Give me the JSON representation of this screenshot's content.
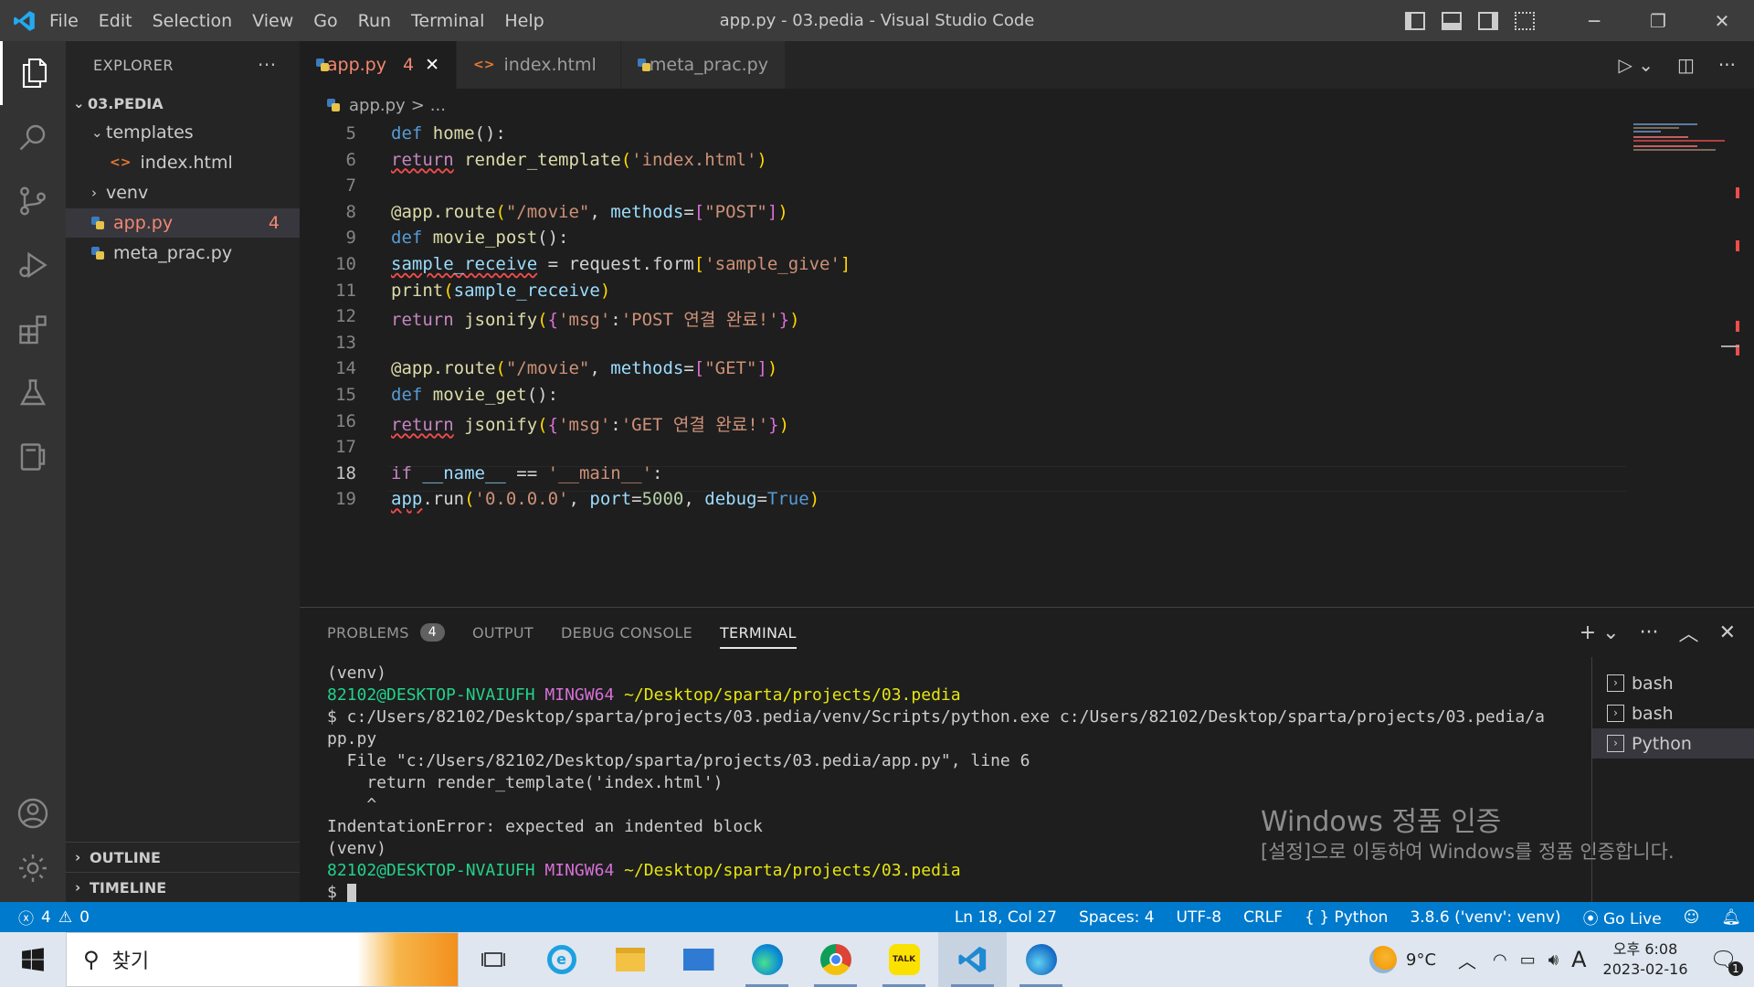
{
  "window": {
    "title": "app.py - 03.pedia - Visual Studio Code",
    "menu": [
      "File",
      "Edit",
      "Selection",
      "View",
      "Go",
      "Run",
      "Terminal",
      "Help"
    ]
  },
  "sidebar": {
    "header": "EXPLORER",
    "more": "···",
    "folder": "03.PEDIA",
    "items": [
      {
        "label": "templates",
        "type": "folder",
        "expanded": true
      },
      {
        "label": "index.html",
        "type": "html"
      },
      {
        "label": "venv",
        "type": "folder",
        "expanded": false
      },
      {
        "label": "app.py",
        "type": "python",
        "badge": "4",
        "active": true
      },
      {
        "label": "meta_prac.py",
        "type": "python"
      }
    ],
    "outline": "OUTLINE",
    "timeline": "TIMELINE"
  },
  "tabs": [
    {
      "label": "app.py",
      "badge": "4",
      "active": true,
      "icon": "python-icon"
    },
    {
      "label": "index.html",
      "icon": "html-icon"
    },
    {
      "label": "meta_prac.py",
      "icon": "python-icon"
    }
  ],
  "breadcrumb": {
    "file": "app.py",
    "sep": ">",
    "rest": "..."
  },
  "editor": {
    "lines": [
      {
        "n": "5",
        "parts": [
          [
            "kw",
            "def "
          ],
          [
            "fn",
            "home"
          ],
          [
            "",
            "():"
          ]
        ]
      },
      {
        "n": "6",
        "parts": [
          [
            "ret sq",
            "return"
          ],
          [
            "",
            " "
          ],
          [
            "fn",
            "render_template"
          ],
          [
            "br",
            "("
          ],
          [
            "st",
            "'index.html'"
          ],
          [
            "br",
            ")"
          ]
        ]
      },
      {
        "n": "7",
        "parts": []
      },
      {
        "n": "8",
        "parts": [
          [
            "fn",
            "@app.route"
          ],
          [
            "br",
            "("
          ],
          [
            "st",
            "\"/movie\""
          ],
          [
            "",
            ", "
          ],
          [
            "pa",
            "methods"
          ],
          [
            "",
            "="
          ],
          [
            "br2",
            "["
          ],
          [
            "st",
            "\"POST\""
          ],
          [
            "br2",
            "]"
          ],
          [
            "br",
            ")"
          ]
        ]
      },
      {
        "n": "9",
        "parts": [
          [
            "kw",
            "def "
          ],
          [
            "fn",
            "movie_post"
          ],
          [
            "",
            "():"
          ]
        ]
      },
      {
        "n": "10",
        "parts": [
          [
            "pa sq",
            "sample_receive"
          ],
          [
            "",
            " = request.form"
          ],
          [
            "br",
            "["
          ],
          [
            "st",
            "'sample_give'"
          ],
          [
            "br",
            "]"
          ]
        ]
      },
      {
        "n": "11",
        "parts": [
          [
            "fn",
            "print"
          ],
          [
            "br",
            "("
          ],
          [
            "pa",
            "sample_receive"
          ],
          [
            "br",
            ")"
          ]
        ]
      },
      {
        "n": "12",
        "parts": [
          [
            "ret",
            "return"
          ],
          [
            "",
            " "
          ],
          [
            "fn",
            "jsonify"
          ],
          [
            "br",
            "("
          ],
          [
            "br2",
            "{"
          ],
          [
            "st",
            "'msg'"
          ],
          [
            "",
            ":"
          ],
          [
            "st",
            "'POST 연결 완료!'"
          ],
          [
            "br2",
            "}"
          ],
          [
            "br",
            ")"
          ]
        ]
      },
      {
        "n": "13",
        "parts": []
      },
      {
        "n": "14",
        "parts": [
          [
            "fn",
            "@app.route"
          ],
          [
            "br",
            "("
          ],
          [
            "st",
            "\"/movie\""
          ],
          [
            "",
            ", "
          ],
          [
            "pa",
            "methods"
          ],
          [
            "",
            "="
          ],
          [
            "br2",
            "["
          ],
          [
            "st",
            "\"GET\""
          ],
          [
            "br2",
            "]"
          ],
          [
            "br",
            ")"
          ]
        ]
      },
      {
        "n": "15",
        "parts": [
          [
            "kw",
            "def "
          ],
          [
            "fn",
            "movie_get"
          ],
          [
            "",
            "():"
          ]
        ]
      },
      {
        "n": "16",
        "parts": [
          [
            "ret sq",
            "return"
          ],
          [
            "",
            " "
          ],
          [
            "fn",
            "jsonify"
          ],
          [
            "br",
            "("
          ],
          [
            "br2",
            "{"
          ],
          [
            "st",
            "'msg'"
          ],
          [
            "",
            ":"
          ],
          [
            "st",
            "'GET 연결 완료!'"
          ],
          [
            "br2",
            "}"
          ],
          [
            "br",
            ")"
          ]
        ]
      },
      {
        "n": "17",
        "parts": []
      },
      {
        "n": "18",
        "parts": [
          [
            "ret",
            "if"
          ],
          [
            "",
            " "
          ],
          [
            "pa",
            "__name__"
          ],
          [
            "",
            " == "
          ],
          [
            "st",
            "'__main__'"
          ],
          [
            "",
            ":"
          ]
        ],
        "current": true
      },
      {
        "n": "19",
        "parts": [
          [
            "pa sq",
            "app"
          ],
          [
            "",
            ".run"
          ],
          [
            "br",
            "("
          ],
          [
            "st",
            "'0.0.0.0'"
          ],
          [
            "",
            ", "
          ],
          [
            "pa",
            "port"
          ],
          [
            "",
            "="
          ],
          [
            "num",
            "5000"
          ],
          [
            "",
            ", "
          ],
          [
            "pa",
            "debug"
          ],
          [
            "",
            "="
          ],
          [
            "kw",
            "True"
          ],
          [
            "br",
            ")"
          ]
        ]
      }
    ]
  },
  "panel": {
    "tabs": [
      {
        "label": "PROBLEMS",
        "badge": "4"
      },
      {
        "label": "OUTPUT"
      },
      {
        "label": "DEBUG CONSOLE"
      },
      {
        "label": "TERMINAL",
        "active": true
      }
    ],
    "terminal": {
      "venv1": "(venv)",
      "prompt_user": "82102@DESKTOP-NVAIUFH",
      "prompt_host": "MINGW64",
      "prompt_path": "~/Desktop/sparta/projects/03.pedia",
      "cmd1": "$ c:/Users/82102/Desktop/sparta/projects/03.pedia/venv/Scripts/python.exe c:/Users/82102/Desktop/sparta/projects/03.pedia/a",
      "cmd2": "pp.py",
      "err1": "  File \"c:/Users/82102/Desktop/sparta/projects/03.pedia/app.py\", line 6",
      "err2": "    return render_template('index.html')",
      "err3": "    ^",
      "err4": "IndentationError: expected an indented block",
      "venv2": "(venv)",
      "prompt2_user": "82102@DESKTOP-NVAIUFH",
      "prompt2_host": "MINGW64",
      "prompt2_path": "~/Desktop/sparta/projects/03.pedia",
      "dollar": "$ "
    },
    "terminal_list": [
      {
        "label": "bash"
      },
      {
        "label": "bash"
      },
      {
        "label": "Python",
        "active": true
      }
    ]
  },
  "watermark": {
    "title": "Windows 정품 인증",
    "body": "[설정]으로 이동하여 Windows를 정품 인증합니다."
  },
  "statusbar": {
    "errors": "4",
    "warnings": "0",
    "position": "Ln 18, Col 27",
    "spaces": "Spaces: 4",
    "encoding": "UTF-8",
    "eol": "CRLF",
    "language": "Python",
    "interpreter": "3.8.6 ('venv': venv)",
    "golive": "Go Live"
  },
  "taskbar": {
    "search_placeholder": "찾기",
    "weather": "9°C",
    "ime": "A",
    "time": "오후 6:08",
    "date": "2023-02-16",
    "notifications": "1"
  },
  "colors": {
    "accent": "#007acc",
    "error": "#f14c4c",
    "tab_error": "#f48771"
  }
}
